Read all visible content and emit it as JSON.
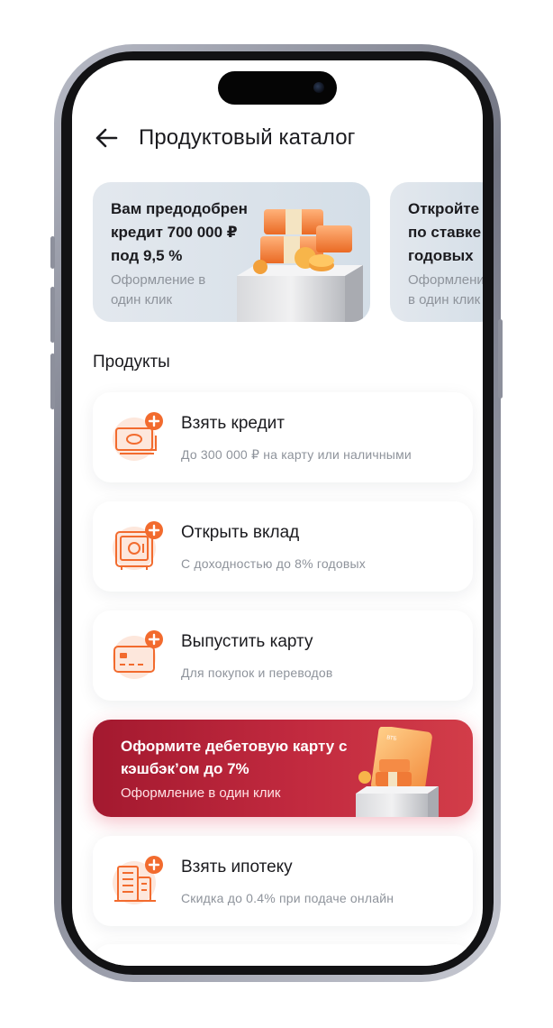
{
  "header": {
    "title": "Продуктовый каталог"
  },
  "banners": [
    {
      "title": "Вам предодобрен кредит 700 000 ₽ под 9,5 %",
      "subtitle": "Оформление в один клик"
    },
    {
      "title": "Откройте по ставке годовых",
      "subtitle": "Оформление в один клик"
    }
  ],
  "section": {
    "title": "Продукты"
  },
  "products": [
    {
      "title": "Взять кредит",
      "subtitle": "До 300 000 ₽ на карту или наличными",
      "icon": "cash-plus-icon"
    },
    {
      "title": "Открыть вклад",
      "subtitle": "С доходностью до 8% годовых",
      "icon": "safe-plus-icon"
    },
    {
      "title": "Выпустить карту",
      "subtitle": "Для покупок и переводов",
      "icon": "card-plus-icon"
    },
    {
      "title": "Взять ипотеку",
      "subtitle": "Скидка до 0.4% при подаче онлайн",
      "icon": "building-plus-icon"
    }
  ],
  "promo": {
    "title": "Оформите дебетовую карту с кэшбэк’ом до 7%",
    "subtitle": "Оформление в один клик",
    "card_text": "ВТБ"
  },
  "colors": {
    "accent": "#f26b2e",
    "promo_bg": "#b8233a",
    "text": "#1b1b1f",
    "muted": "#8e939b"
  }
}
